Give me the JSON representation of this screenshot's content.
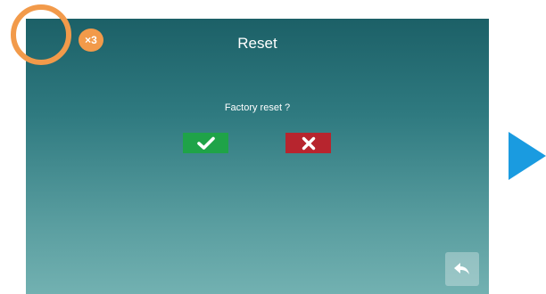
{
  "screen": {
    "title": "Reset",
    "question": "Factory reset ?",
    "confirm_icon": "checkmark-icon",
    "cancel_icon": "x-icon",
    "back_icon": "return-arrow-icon"
  },
  "annotation": {
    "tap_count": "×3",
    "next_icon": "play-arrow-icon"
  },
  "colors": {
    "confirm": "#1fa348",
    "cancel": "#b7252e",
    "tap_highlight": "#f29a4a",
    "next_arrow": "#1a9be0"
  }
}
